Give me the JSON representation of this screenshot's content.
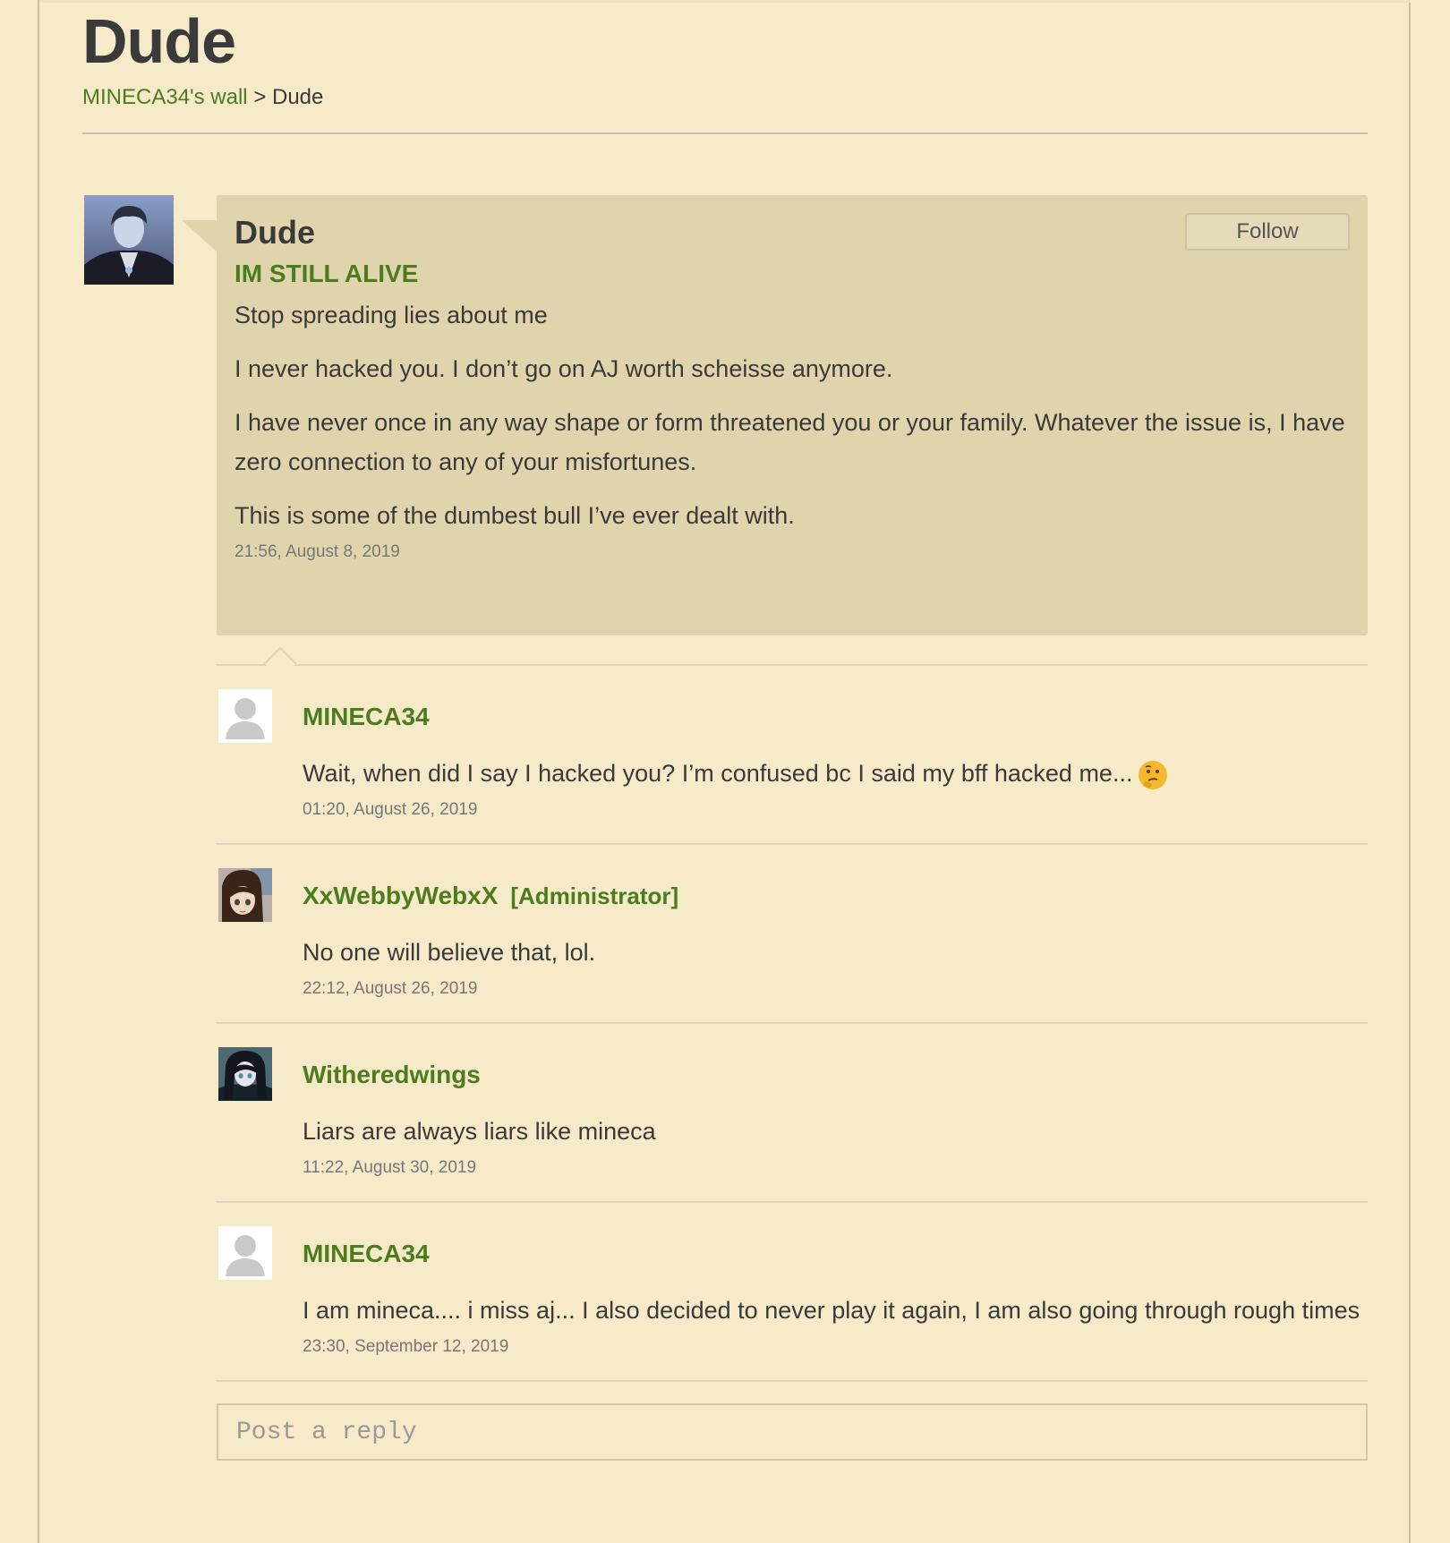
{
  "page": {
    "title": "Dude",
    "breadcrumb": {
      "wall_link": "MINECA34's wall",
      "separator": ">",
      "current": "Dude"
    }
  },
  "post": {
    "author": "Dude",
    "subject": "IM STILL ALIVE",
    "follow_label": "Follow",
    "paragraphs": [
      "Stop spreading lies about me",
      "I never hacked you. I don’t go on AJ worth scheisse anymore.",
      "I have never once in any way shape or form threatened you or your family. Whatever the issue is, I have zero connection to any of your misfortunes.",
      "This is some of the dumbest bull I’ve ever dealt with."
    ],
    "timestamp": "21:56, August 8, 2019"
  },
  "replies": [
    {
      "author": "MINECA34",
      "role": "",
      "avatar": "default-user-icon",
      "text": "Wait, when did I say I hacked you? I’m confused bc I said my bff hacked me...",
      "emoji": "thinking-face-icon",
      "timestamp": "01:20, August 26, 2019"
    },
    {
      "author": "XxWebbyWebxX",
      "role": "[Administrator]",
      "avatar": "anime-girl-avatar",
      "text": "No one will believe that, lol.",
      "timestamp": "22:12, August 26, 2019"
    },
    {
      "author": "Witheredwings",
      "role": "",
      "avatar": "anime-boy-avatar",
      "text": "Liars are always liars like mineca",
      "timestamp": "11:22, August 30, 2019"
    },
    {
      "author": "MINECA34",
      "role": "",
      "avatar": "default-user-icon",
      "text": "I am mineca.... i miss aj... I also decided to never play it again, I am also going through rough times",
      "timestamp": "23:30, September 12, 2019"
    }
  ],
  "reply_box": {
    "placeholder": "Post a reply"
  },
  "colors": {
    "background": "#f7eac9",
    "post_box": "#e0d4ad",
    "link_green": "#4b7d1e",
    "text": "#3a3a3a"
  }
}
